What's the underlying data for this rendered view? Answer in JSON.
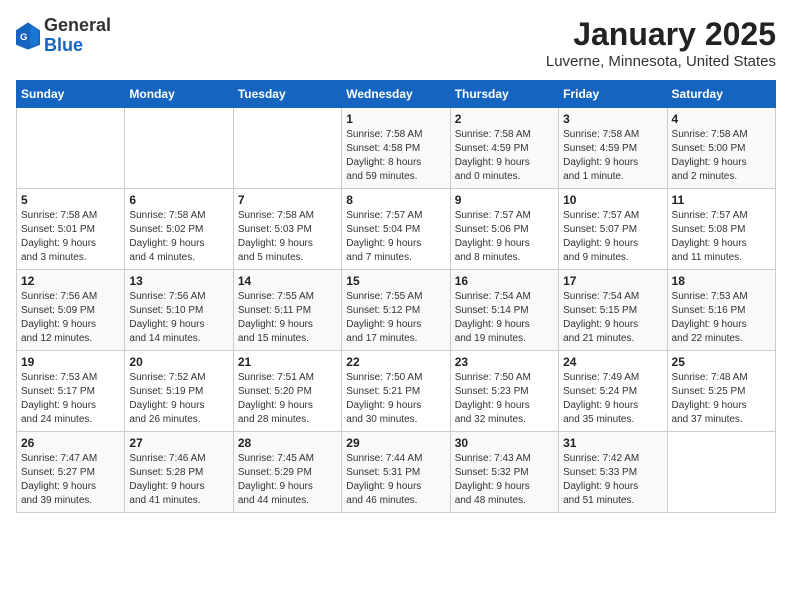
{
  "header": {
    "logo_general": "General",
    "logo_blue": "Blue",
    "month": "January 2025",
    "location": "Luverne, Minnesota, United States"
  },
  "weekdays": [
    "Sunday",
    "Monday",
    "Tuesday",
    "Wednesday",
    "Thursday",
    "Friday",
    "Saturday"
  ],
  "weeks": [
    [
      {
        "day": "",
        "info": ""
      },
      {
        "day": "",
        "info": ""
      },
      {
        "day": "",
        "info": ""
      },
      {
        "day": "1",
        "info": "Sunrise: 7:58 AM\nSunset: 4:58 PM\nDaylight: 8 hours\nand 59 minutes."
      },
      {
        "day": "2",
        "info": "Sunrise: 7:58 AM\nSunset: 4:59 PM\nDaylight: 9 hours\nand 0 minutes."
      },
      {
        "day": "3",
        "info": "Sunrise: 7:58 AM\nSunset: 4:59 PM\nDaylight: 9 hours\nand 1 minute."
      },
      {
        "day": "4",
        "info": "Sunrise: 7:58 AM\nSunset: 5:00 PM\nDaylight: 9 hours\nand 2 minutes."
      }
    ],
    [
      {
        "day": "5",
        "info": "Sunrise: 7:58 AM\nSunset: 5:01 PM\nDaylight: 9 hours\nand 3 minutes."
      },
      {
        "day": "6",
        "info": "Sunrise: 7:58 AM\nSunset: 5:02 PM\nDaylight: 9 hours\nand 4 minutes."
      },
      {
        "day": "7",
        "info": "Sunrise: 7:58 AM\nSunset: 5:03 PM\nDaylight: 9 hours\nand 5 minutes."
      },
      {
        "day": "8",
        "info": "Sunrise: 7:57 AM\nSunset: 5:04 PM\nDaylight: 9 hours\nand 7 minutes."
      },
      {
        "day": "9",
        "info": "Sunrise: 7:57 AM\nSunset: 5:06 PM\nDaylight: 9 hours\nand 8 minutes."
      },
      {
        "day": "10",
        "info": "Sunrise: 7:57 AM\nSunset: 5:07 PM\nDaylight: 9 hours\nand 9 minutes."
      },
      {
        "day": "11",
        "info": "Sunrise: 7:57 AM\nSunset: 5:08 PM\nDaylight: 9 hours\nand 11 minutes."
      }
    ],
    [
      {
        "day": "12",
        "info": "Sunrise: 7:56 AM\nSunset: 5:09 PM\nDaylight: 9 hours\nand 12 minutes."
      },
      {
        "day": "13",
        "info": "Sunrise: 7:56 AM\nSunset: 5:10 PM\nDaylight: 9 hours\nand 14 minutes."
      },
      {
        "day": "14",
        "info": "Sunrise: 7:55 AM\nSunset: 5:11 PM\nDaylight: 9 hours\nand 15 minutes."
      },
      {
        "day": "15",
        "info": "Sunrise: 7:55 AM\nSunset: 5:12 PM\nDaylight: 9 hours\nand 17 minutes."
      },
      {
        "day": "16",
        "info": "Sunrise: 7:54 AM\nSunset: 5:14 PM\nDaylight: 9 hours\nand 19 minutes."
      },
      {
        "day": "17",
        "info": "Sunrise: 7:54 AM\nSunset: 5:15 PM\nDaylight: 9 hours\nand 21 minutes."
      },
      {
        "day": "18",
        "info": "Sunrise: 7:53 AM\nSunset: 5:16 PM\nDaylight: 9 hours\nand 22 minutes."
      }
    ],
    [
      {
        "day": "19",
        "info": "Sunrise: 7:53 AM\nSunset: 5:17 PM\nDaylight: 9 hours\nand 24 minutes."
      },
      {
        "day": "20",
        "info": "Sunrise: 7:52 AM\nSunset: 5:19 PM\nDaylight: 9 hours\nand 26 minutes."
      },
      {
        "day": "21",
        "info": "Sunrise: 7:51 AM\nSunset: 5:20 PM\nDaylight: 9 hours\nand 28 minutes."
      },
      {
        "day": "22",
        "info": "Sunrise: 7:50 AM\nSunset: 5:21 PM\nDaylight: 9 hours\nand 30 minutes."
      },
      {
        "day": "23",
        "info": "Sunrise: 7:50 AM\nSunset: 5:23 PM\nDaylight: 9 hours\nand 32 minutes."
      },
      {
        "day": "24",
        "info": "Sunrise: 7:49 AM\nSunset: 5:24 PM\nDaylight: 9 hours\nand 35 minutes."
      },
      {
        "day": "25",
        "info": "Sunrise: 7:48 AM\nSunset: 5:25 PM\nDaylight: 9 hours\nand 37 minutes."
      }
    ],
    [
      {
        "day": "26",
        "info": "Sunrise: 7:47 AM\nSunset: 5:27 PM\nDaylight: 9 hours\nand 39 minutes."
      },
      {
        "day": "27",
        "info": "Sunrise: 7:46 AM\nSunset: 5:28 PM\nDaylight: 9 hours\nand 41 minutes."
      },
      {
        "day": "28",
        "info": "Sunrise: 7:45 AM\nSunset: 5:29 PM\nDaylight: 9 hours\nand 44 minutes."
      },
      {
        "day": "29",
        "info": "Sunrise: 7:44 AM\nSunset: 5:31 PM\nDaylight: 9 hours\nand 46 minutes."
      },
      {
        "day": "30",
        "info": "Sunrise: 7:43 AM\nSunset: 5:32 PM\nDaylight: 9 hours\nand 48 minutes."
      },
      {
        "day": "31",
        "info": "Sunrise: 7:42 AM\nSunset: 5:33 PM\nDaylight: 9 hours\nand 51 minutes."
      },
      {
        "day": "",
        "info": ""
      }
    ]
  ]
}
